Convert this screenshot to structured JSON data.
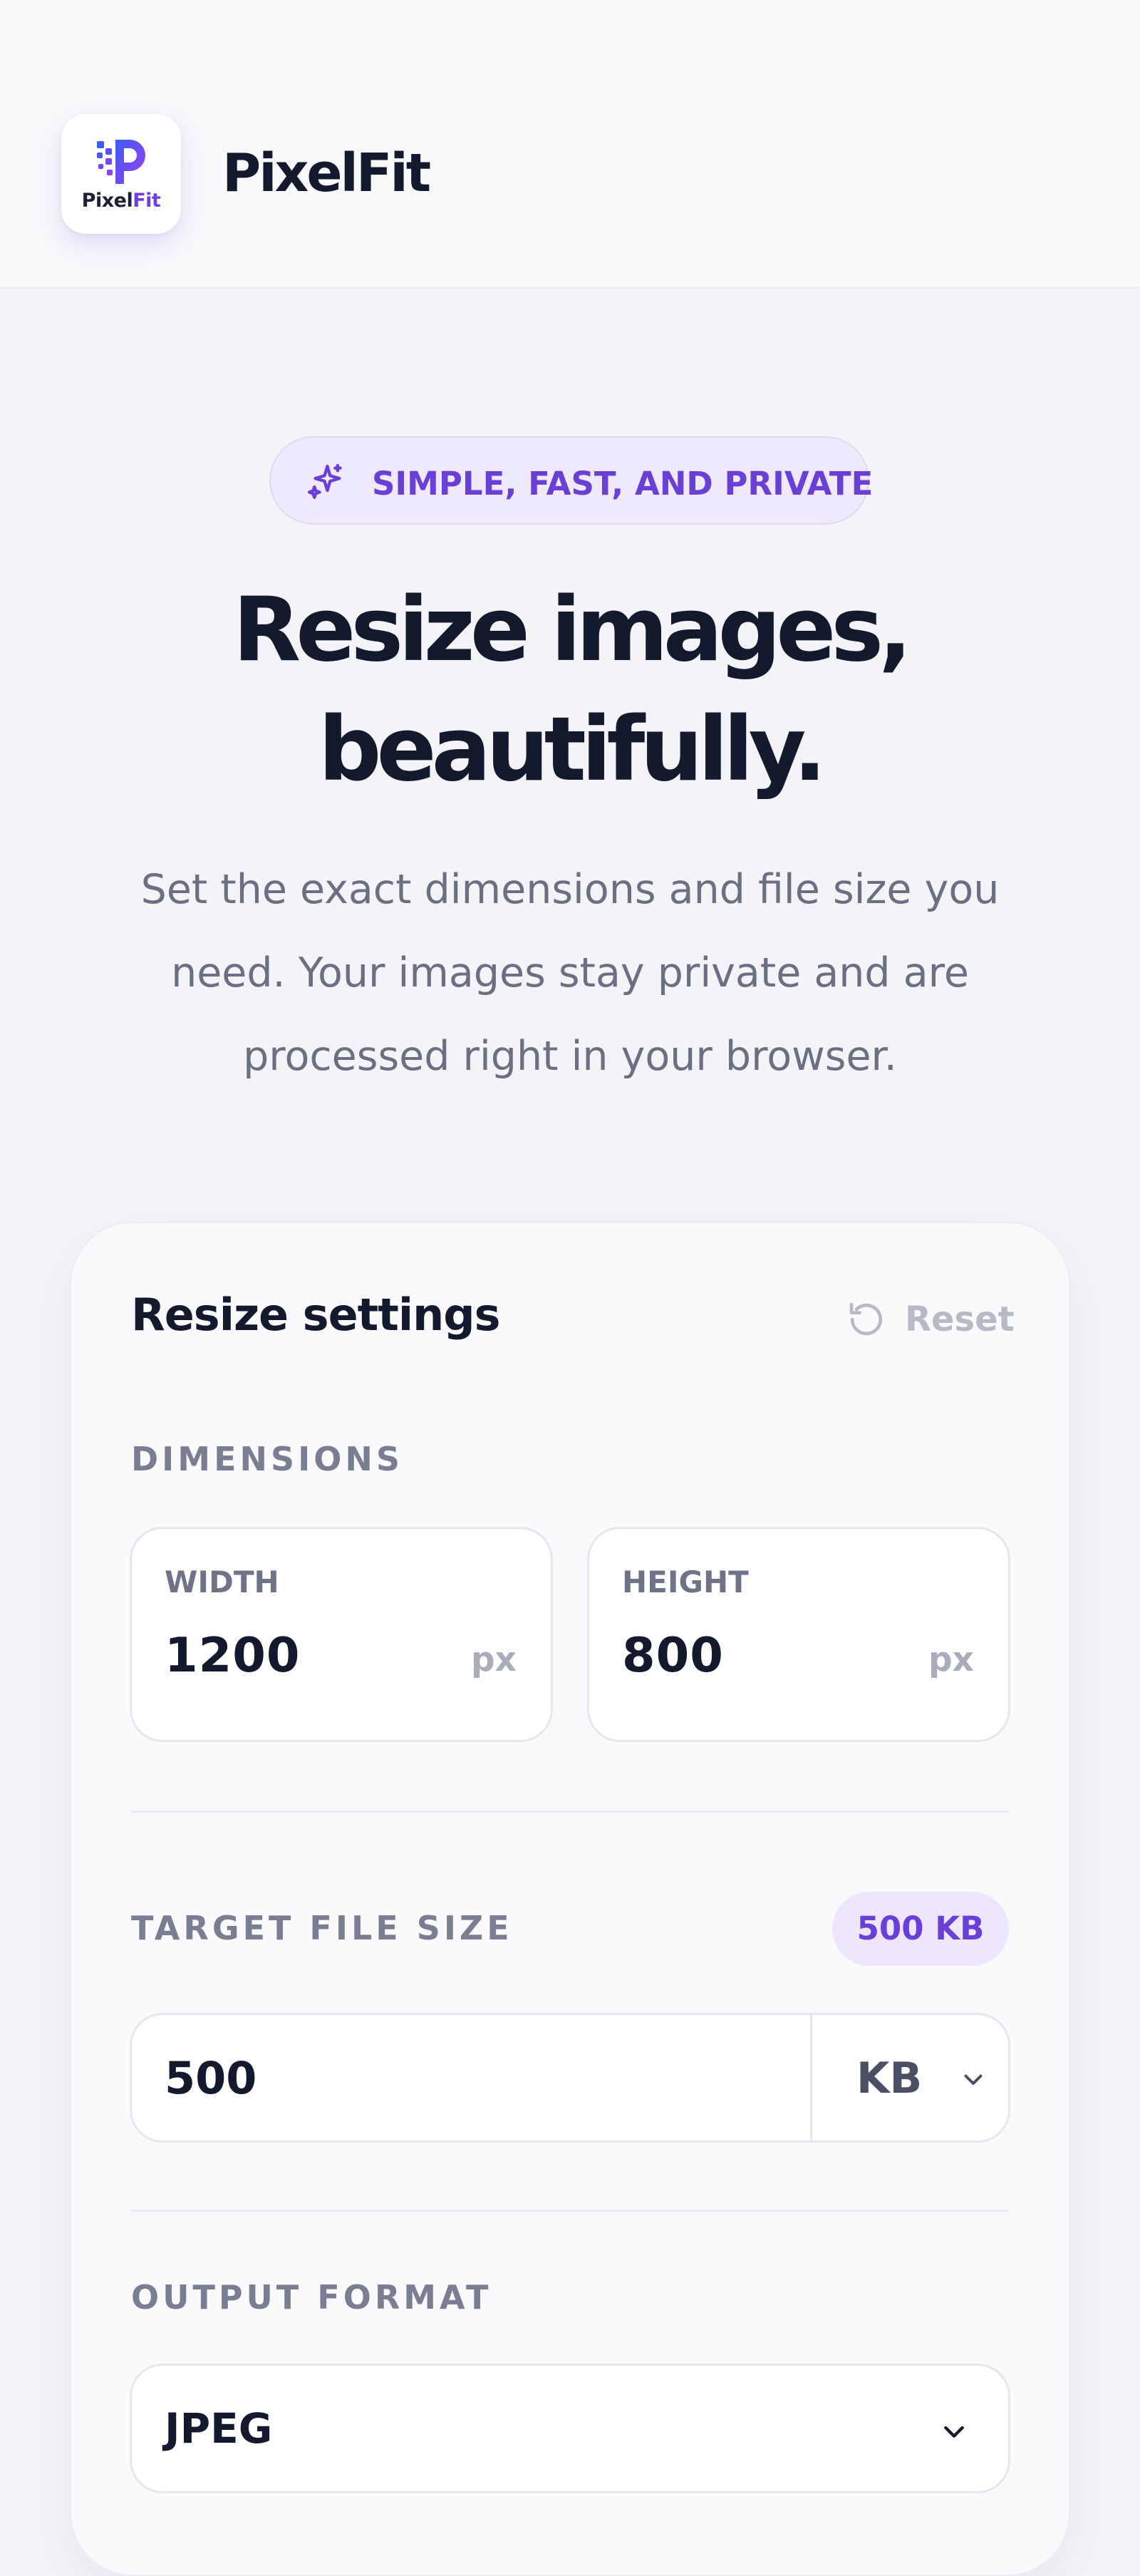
{
  "header": {
    "logo_word_a": "Pixel",
    "logo_word_b": "Fit",
    "brand": "PixelFit"
  },
  "hero": {
    "badge": "SIMPLE, FAST, AND PRIVATE",
    "headline_line1": "Resize images,",
    "headline_line2": "beautifully.",
    "lede_line1": "Set the exact dimensions and file size you",
    "lede_line2": "need. Your images stay private and are",
    "lede_line3": "processed right in your browser."
  },
  "settings": {
    "title": "Resize settings",
    "reset_label": "Reset",
    "dimensions": {
      "label": "DIMENSIONS",
      "width_label": "WIDTH",
      "width_value": "1200",
      "width_unit": "px",
      "height_label": "HEIGHT",
      "height_value": "800",
      "height_unit": "px"
    },
    "file_size": {
      "label": "TARGET FILE SIZE",
      "summary": "500 KB",
      "value": "500",
      "unit": "KB"
    },
    "format": {
      "label": "OUTPUT FORMAT",
      "value": "JPEG"
    }
  },
  "colors": {
    "accent": "#6a3fd6",
    "accent_soft": "#efe9fd",
    "text_primary": "#141a2e",
    "text_muted": "#6b6f84"
  },
  "icons": [
    "pixelfit-logo-icon",
    "sparkle-icon",
    "reset-icon",
    "chevron-down-icon"
  ]
}
